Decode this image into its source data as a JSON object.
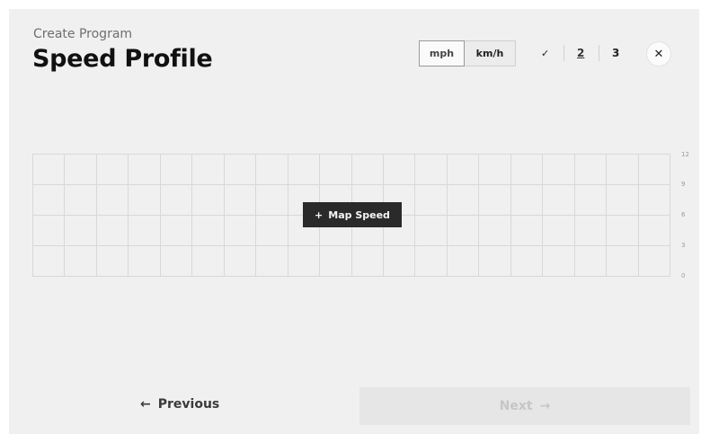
{
  "header": {
    "subtitle": "Create Program",
    "title": "Speed Profile"
  },
  "units": {
    "options": [
      "mph",
      "km/h"
    ],
    "selected": "mph"
  },
  "stepper": {
    "step1_icon": "check-icon",
    "step1_glyph": "✓",
    "step2": "2",
    "step3": "3",
    "current": "2"
  },
  "close": {
    "glyph": "✕"
  },
  "chart": {
    "y_ticks": [
      "12",
      "9",
      "6",
      "3",
      "0"
    ],
    "columns": 20,
    "rows": 4
  },
  "map_speed": {
    "icon": "+",
    "label": "Map Speed"
  },
  "footer": {
    "prev_icon": "←",
    "prev_label": "Previous",
    "next_label": "Next",
    "next_icon": "→"
  },
  "colors": {
    "panel_bg": "#f0f0f0",
    "grid_line": "#d8d8d8",
    "button_dark": "#2a2a2a",
    "next_disabled_bg": "#e6e6e6"
  }
}
